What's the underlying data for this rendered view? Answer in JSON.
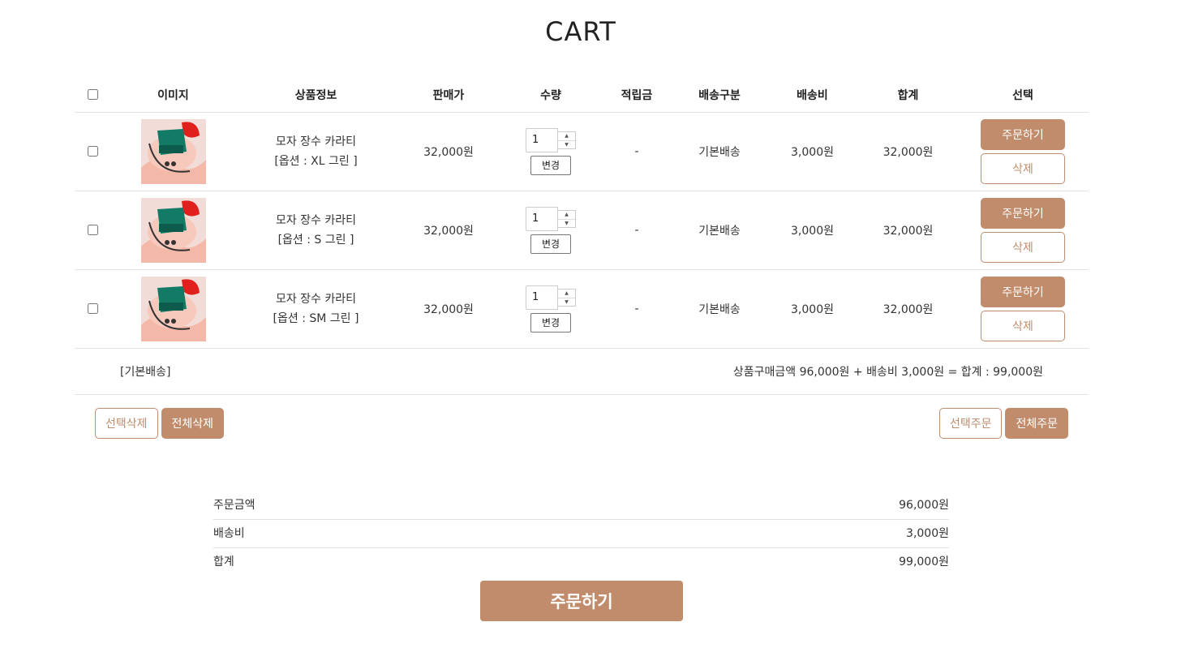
{
  "page": {
    "title": "CART"
  },
  "table": {
    "headers": [
      "이미지",
      "상품정보",
      "판매가",
      "수량",
      "적립금",
      "배송구분",
      "배송비",
      "합계",
      "선택"
    ],
    "rows": [
      {
        "name": "모자 장수 카라티",
        "option": "[옵션 : XL 그린 ]",
        "price": "32,000원",
        "qty": "1",
        "points": "-",
        "ship_type": "기본배송",
        "ship_fee": "3,000원",
        "total": "32,000원"
      },
      {
        "name": "모자 장수 카라티",
        "option": "[옵션 : S 그린 ]",
        "price": "32,000원",
        "qty": "1",
        "points": "-",
        "ship_type": "기본배송",
        "ship_fee": "3,000원",
        "total": "32,000원"
      },
      {
        "name": "모자 장수 카라티",
        "option": "[옵션 : SM 그린 ]",
        "price": "32,000원",
        "qty": "1",
        "points": "-",
        "ship_type": "기본배송",
        "ship_fee": "3,000원",
        "total": "32,000원"
      }
    ],
    "change_label": "변경",
    "order_label": "주문하기",
    "delete_label": "삭제"
  },
  "summary": {
    "ship_label": "[기본배송]",
    "text": "상품구매금액 96,000원 + 배송비 3,000원 = 합계 : 99,000원"
  },
  "actions": {
    "select_delete": "선택삭제",
    "delete_all": "전체삭제",
    "select_order": "선택주문",
    "order_all": "전체주문"
  },
  "totals": {
    "items": [
      {
        "label": "주문금액",
        "value": "96,000원"
      },
      {
        "label": "배송비",
        "value": "3,000원"
      },
      {
        "label": "합계",
        "value": "99,000원"
      }
    ]
  },
  "checkout": {
    "label": "주문하기"
  },
  "colors": {
    "accent": "#c08c6c",
    "border": "#e3e3e3"
  },
  "icons": [
    "product-thumbnail",
    "spin-up-icon",
    "spin-down-icon"
  ]
}
